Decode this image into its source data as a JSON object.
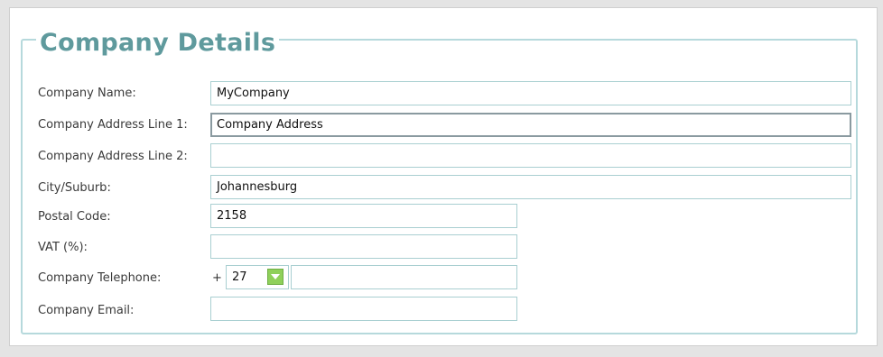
{
  "section": {
    "title": "Company Details"
  },
  "fields": {
    "company_name": {
      "label": "Company Name:",
      "value": "MyCompany"
    },
    "address_line_1": {
      "label": "Company Address Line 1:",
      "value": "Company Address"
    },
    "address_line_2": {
      "label": "Company Address Line 2:",
      "value": ""
    },
    "city_suburb": {
      "label": "City/Suburb:",
      "value": "Johannesburg"
    },
    "postal_code": {
      "label": "Postal Code:",
      "value": "2158"
    },
    "vat": {
      "label": "VAT (%):",
      "value": ""
    },
    "telephone": {
      "label": "Company Telephone:",
      "prefix": "+",
      "country_code": "27",
      "dropdown_icon": "chevron-down-icon",
      "number": ""
    },
    "email": {
      "label": "Company Email:",
      "value": ""
    }
  },
  "colors": {
    "heading": "#5f9a9d",
    "fieldset_border": "#b6d9dc",
    "input_border": "#a9cfd1",
    "dropdown_button": "#8fd05a"
  }
}
